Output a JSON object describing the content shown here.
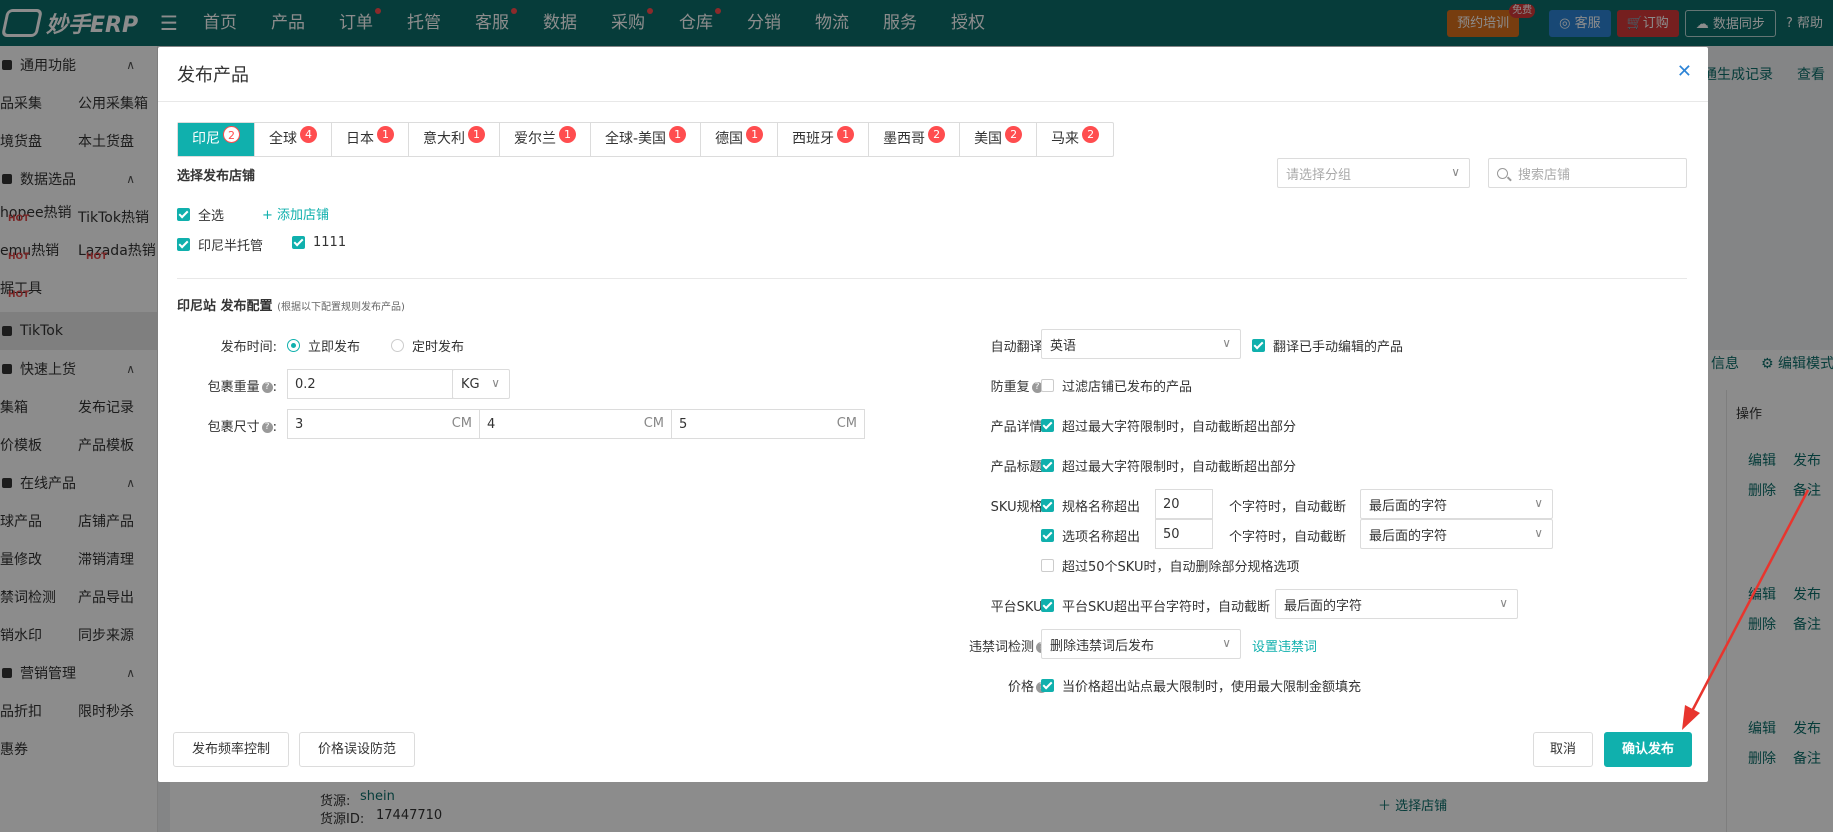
{
  "topnav": {
    "logo_text": "妙手ERP",
    "items": [
      {
        "label": "首页",
        "dot": false
      },
      {
        "label": "产品",
        "dot": false
      },
      {
        "label": "订单",
        "dot": true
      },
      {
        "label": "托管",
        "dot": false
      },
      {
        "label": "客服",
        "dot": true
      },
      {
        "label": "数据",
        "dot": false
      },
      {
        "label": "采购",
        "dot": true
      },
      {
        "label": "仓库",
        "dot": true
      },
      {
        "label": "分销",
        "dot": false
      },
      {
        "label": "物流",
        "dot": false
      },
      {
        "label": "服务",
        "dot": false
      },
      {
        "label": "授权",
        "dot": false
      }
    ],
    "training": "预约培训",
    "training_badge": "免费",
    "service": "客服",
    "order": "订购",
    "sync": "数据同步",
    "help": "帮助"
  },
  "sidebar": {
    "sections": [
      {
        "title": "通用功能",
        "rows": [
          [
            "品采集",
            "公用采集箱"
          ],
          [
            "境货盘",
            "本土货盘"
          ]
        ]
      },
      {
        "title": "数据选品",
        "rows": [
          [
            "hopee热销",
            "TikTok热销"
          ],
          [
            "emu热销",
            "Lazada热销"
          ],
          [
            "据工具",
            ""
          ]
        ]
      },
      {
        "title": "TikTok",
        "rows": []
      },
      {
        "title": "快速上货",
        "rows": [
          [
            "集箱",
            "发布记录"
          ],
          [
            "价模板",
            "产品模板"
          ]
        ]
      },
      {
        "title": "在线产品",
        "rows": [
          [
            "球产品",
            "店铺产品"
          ],
          [
            "量修改",
            "滞销清理"
          ],
          [
            "禁词检测",
            "产品导出"
          ],
          [
            "销水印",
            "同步来源"
          ]
        ]
      },
      {
        "title": "营销管理",
        "rows": [
          [
            "品折扣",
            "限时秒杀"
          ],
          [
            "惠券",
            ""
          ]
        ]
      }
    ],
    "hot": "HOT"
  },
  "background": {
    "gen_record": "通生成记录",
    "view": "查看",
    "info": "信息",
    "edit_mode": "编辑模式",
    "op_header": "操作",
    "edit": "编辑",
    "publish": "发布",
    "delete": "删除",
    "note": "备注",
    "source": "货源:",
    "source_val": "shein",
    "source_id_label": "货源ID:",
    "source_id": "17447710",
    "select_store": "选择店铺"
  },
  "modal": {
    "title": "发布产品",
    "tabs": [
      {
        "label": "印尼",
        "count": "2",
        "active": true
      },
      {
        "label": "全球",
        "count": "4",
        "active": false
      },
      {
        "label": "日本",
        "count": "1",
        "active": false
      },
      {
        "label": "意大利",
        "count": "1",
        "active": false
      },
      {
        "label": "爱尔兰",
        "count": "1",
        "active": false
      },
      {
        "label": "全球-美国",
        "count": "1",
        "active": false
      },
      {
        "label": "德国",
        "count": "1",
        "active": false
      },
      {
        "label": "西班牙",
        "count": "1",
        "active": false
      },
      {
        "label": "墨西哥",
        "count": "2",
        "active": false
      },
      {
        "label": "美国",
        "count": "2",
        "active": false
      },
      {
        "label": "马来",
        "count": "2",
        "active": false
      }
    ],
    "store_section": "选择发布店铺",
    "group_placeholder": "请选择分组",
    "search_placeholder": "搜索店铺",
    "select_all": "全选",
    "add_store": "+ 添加店铺",
    "stores": [
      "印尼半托管",
      "1111"
    ],
    "config_title": "印尼站 发布配置",
    "config_hint": "(根据以下配置规则发布产品)",
    "left": {
      "publish_time_label": "发布时间:",
      "publish_now": "立即发布",
      "publish_scheduled": "定时发布",
      "weight_label": "包裹重量",
      "weight_value": "0.2",
      "weight_unit": "KG",
      "size_label": "包裹尺寸",
      "size_values": [
        "3",
        "4",
        "5"
      ],
      "size_unit": "CM"
    },
    "right": {
      "translate_label": "自动翻译:",
      "translate_value": "英语",
      "translate_manual": "翻译已手动编辑的产品",
      "dedupe_label": "防重复",
      "dedupe_text": "过滤店铺已发布的产品",
      "detail_label": "产品详情:",
      "detail_text": "超过最大字符限制时，自动截断超出部分",
      "title_label": "产品标题:",
      "title_text": "超过最大字符限制时，自动截断超出部分",
      "sku_label": "SKU规格:",
      "sku_name_text": "规格名称超出",
      "sku_name_value": "20",
      "sku_option_text": "选项名称超出",
      "sku_option_value": "50",
      "sku_suffix": "个字符时，自动截断",
      "sku_trunc_select": "最后面的字符",
      "sku_over50": "超过50个SKU时，自动删除部分规格选项",
      "platform_sku_label": "平台SKU:",
      "platform_sku_text": "平台SKU超出平台字符时，自动截断",
      "platform_sku_select": "最后面的字符",
      "banned_label": "违禁词检测",
      "banned_select": "删除违禁词后发布",
      "banned_link": "设置违禁词",
      "price_label": "价格",
      "price_text": "当价格超出站点最大限制时，使用最大限制金额填充"
    },
    "footer": {
      "rate_control": "发布频率控制",
      "price_guard": "价格误设防范",
      "cancel": "取消",
      "confirm": "确认发布"
    }
  },
  "colors": {
    "brand": "#0c6e6a",
    "accent": "#10b0ad",
    "badge": "#ff4d4f",
    "arrow": "#e8352e"
  }
}
